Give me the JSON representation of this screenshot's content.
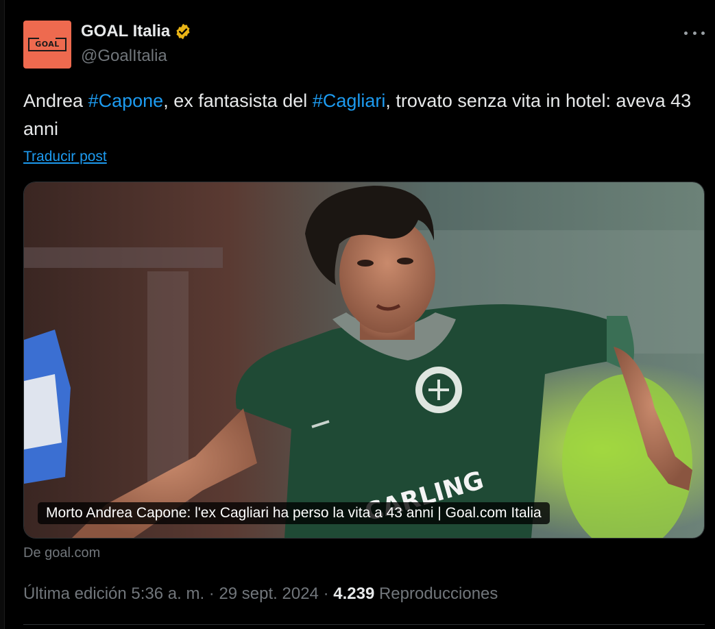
{
  "author": {
    "display_name": "GOAL Italia",
    "handle": "@GoalItalia",
    "avatar_text": "GOAL",
    "avatar_color": "#ee6a4f",
    "verified_color": "#e9b416"
  },
  "tweet": {
    "text_part1": "Andrea ",
    "hashtag1": "#Capone",
    "text_part2": ", ex fantasista del ",
    "hashtag2": "#Cagliari",
    "text_part3": ", trovato senza vita in hotel: aveva 43 anni",
    "translate_label": "Traducir post"
  },
  "card": {
    "caption": "Morto Andrea Capone: l'ex Cagliari ha perso la vita a 43 anni | Goal.com Italia",
    "jersey_text": "CARLING",
    "source": "De goal.com"
  },
  "meta": {
    "edited_label": "Última edición 5:36 a. m. · 29 sept. 2024 · ",
    "views_count": "4.239",
    "views_label": " Reproducciones"
  },
  "colors": {
    "background": "#000000",
    "text": "#e7e9ea",
    "muted": "#71767b",
    "link": "#1d9bf0"
  }
}
